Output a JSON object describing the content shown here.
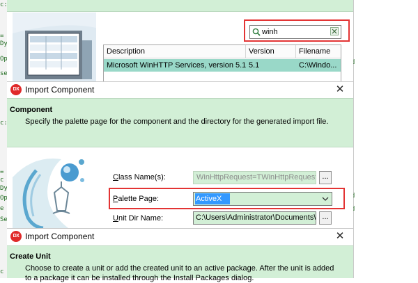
{
  "bg_code_fragments": [
    "c:",
    "=",
    "Dy",
    "Op",
    "se",
    "c:",
    "=",
    "c",
    "Dy",
    "Op",
    "e",
    "Se",
    "c"
  ],
  "right_fragments": [
    "d",
    "d",
    "d"
  ],
  "dialog1": {
    "search": {
      "value": "winh",
      "icon": "search-icon",
      "clear_icon": "clear-icon"
    },
    "grid": {
      "columns": [
        "Description",
        "Version",
        "Filename"
      ],
      "rows": [
        {
          "description": "Microsoft WinHTTP Services, version 5.1",
          "version": "5.1",
          "filename": "C:\\Windo..."
        }
      ]
    }
  },
  "dialog2": {
    "title": "Import Component",
    "app_icon_text": "DX",
    "header": {
      "title": "Component",
      "description": "Specify the palette page for the component and the directory for the generated import file."
    },
    "fields": {
      "class_name": {
        "label_underline": "C",
        "label_rest": "lass Name(s):",
        "value": "WinHttpRequest=TWinHttpRequest",
        "browse": "..."
      },
      "palette_page": {
        "label_underline": "P",
        "label_rest": "alette Page:",
        "value": "ActiveX"
      },
      "unit_dir": {
        "label_underline": "U",
        "label_rest": "nit Dir Name:",
        "value": "C:\\Users\\Administrator\\Documents\\Em",
        "browse": "..."
      }
    }
  },
  "dialog3": {
    "title": "Import Component",
    "app_icon_text": "DX",
    "header": {
      "title": "Create Unit",
      "description_line1": "Choose to create a unit or add the created unit to an active package. After the unit is added",
      "description_line2": "to a package it can be installed through the Install Packages dialog."
    }
  },
  "colors": {
    "panel_green": "#d2efd6",
    "selection": "#99d8c8",
    "highlight": "#e33434",
    "dx_red": "#e02a2a"
  }
}
